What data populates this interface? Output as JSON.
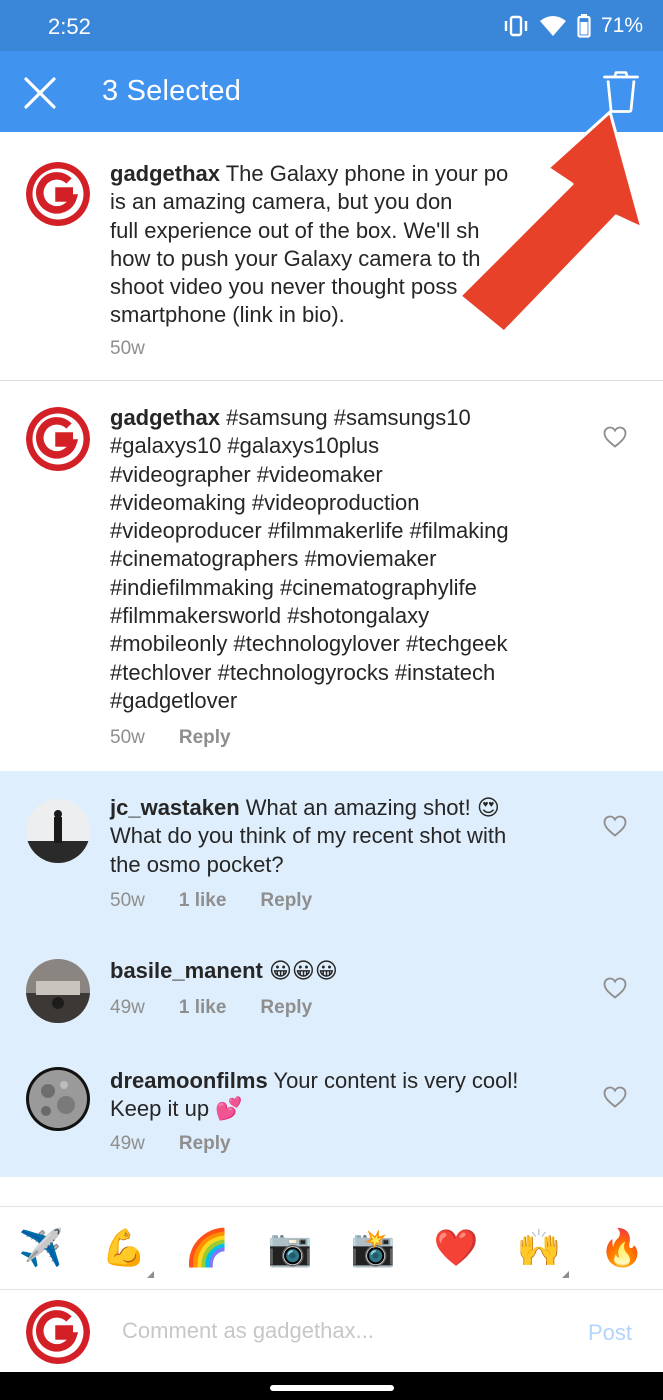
{
  "status_bar": {
    "time": "2:52",
    "battery": "71%"
  },
  "action_bar": {
    "title": "3 Selected"
  },
  "caption": {
    "username": "gadgethax",
    "text": " The Galaxy phone in your po is an amazing camera, but you don't full experience out of the box. We'll sh how to push your Galaxy camera to th na o shoot video you never thought poss e on a smartphone (link in bio).",
    "lines": [
      " The Galaxy phone in your po",
      "is an amazing camera, but you don",
      "full experience out of the box. We'll sh",
      "how to push your Galaxy camera to th    na    o",
      "shoot video you never thought poss    e on a",
      "smartphone (link in bio)."
    ],
    "time": "50w"
  },
  "comments": [
    {
      "username": "gadgethax",
      "lines": [
        " #samsung #samsungs10",
        "#galaxys10 #galaxys10plus",
        "#videographer #videomaker",
        "#videomaking #videoproduction",
        "#videoproducer #filmmakerlife #filmaking",
        "#cinematographers #moviemaker",
        "#indiefilmmaking #cinematographylife",
        "#filmmakersworld #shotongalaxy",
        "#mobileonly #technologylover #techgeek",
        "#techlover #technologyrocks #instatech",
        "#gadgetlover"
      ],
      "time": "50w",
      "reply": "Reply"
    },
    {
      "username": "jc_wastaken",
      "lines": [
        " What an amazing shot! 😍",
        "What do you think of my recent shot with",
        "the osmo pocket?"
      ],
      "time": "50w",
      "likes": "1 like",
      "reply": "Reply",
      "selected": true
    },
    {
      "username": "basile_manent",
      "lines": [
        " 😀😀😀"
      ],
      "time": "49w",
      "likes": "1 like",
      "reply": "Reply",
      "selected": true
    },
    {
      "username": "dreamoonfilms",
      "lines": [
        " Your content is very cool!",
        "Keep it up 💕"
      ],
      "time": "49w",
      "reply": "Reply",
      "selected": true
    }
  ],
  "quick_emojis": [
    "✈️",
    "💪",
    "🌈",
    "📷",
    "📸",
    "❤️",
    "🙌",
    "🔥"
  ],
  "composer": {
    "placeholder": "Comment as gadgethax...",
    "post_label": "Post"
  },
  "colors": {
    "status_bar": "#3a87d9",
    "action_bar": "#4193f0",
    "selected_bg": "#dfeefc",
    "brand_red": "#d32027",
    "annotation_arrow": "#e8412a"
  },
  "icons": [
    "close-icon",
    "trash-icon",
    "heart-icon",
    "vibrate-icon",
    "wifi-icon",
    "battery-icon",
    "arrow-annotation"
  ]
}
